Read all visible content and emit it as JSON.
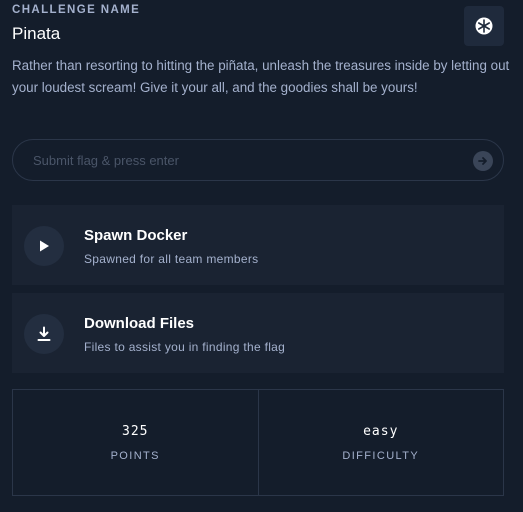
{
  "challenge": {
    "section_label": "CHALLENGE NAME",
    "name": "Pinata",
    "category_icon": "web-snowflake-icon",
    "description": "Rather than resorting to hitting the piñata, unleash the treasures inside by letting out your loudest scream! Give it your all, and the goodies shall be yours!"
  },
  "flag_input": {
    "placeholder": "Submit flag & press enter",
    "value": "",
    "submit_icon": "arrow-right-circle-icon"
  },
  "actions": [
    {
      "title": "Spawn Docker",
      "subtitle": "Spawned for all team members",
      "icon": "play-icon"
    },
    {
      "title": "Download Files",
      "subtitle": "Files to assist you in finding the flag",
      "icon": "download-icon"
    }
  ],
  "stats": {
    "points_value": "325",
    "points_label": "POINTS",
    "difficulty_value": "easy",
    "difficulty_label": "DIFFICULTY"
  },
  "colors": {
    "background": "#141d2b",
    "card": "#1a2332",
    "muted_text": "#a4b1cd",
    "border": "#2b3649"
  }
}
